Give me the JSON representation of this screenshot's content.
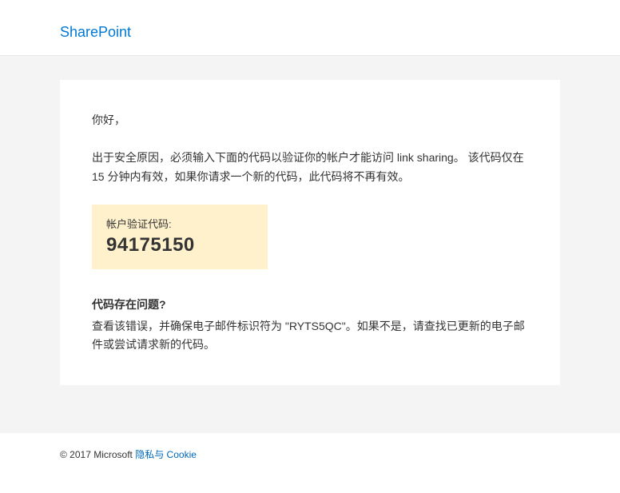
{
  "header": {
    "brand": "SharePoint"
  },
  "content": {
    "greeting": "你好，",
    "instruction": "出于安全原因，必须输入下面的代码以验证你的帐户才能访问 link sharing。 该代码仅在 15 分钟内有效，如果你请求一个新的代码，此代码将不再有效。",
    "code_label": "帐户验证代码:",
    "code_value": "94175150",
    "trouble_title": "代码存在问题?",
    "trouble_text": "查看该错误，并确保电子邮件标识符为 \"RYTS5QC\"。如果不是，请查找已更新的电子邮件或尝试请求新的代码。"
  },
  "footer": {
    "copyright": "© 2017 Microsoft ",
    "link_text": "隐私与 Cookie"
  }
}
